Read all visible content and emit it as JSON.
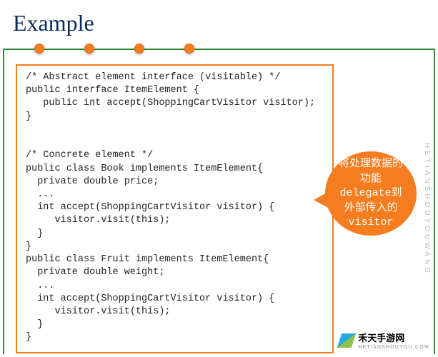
{
  "title": "Example",
  "code": "/* Abstract element interface (visitable) */\npublic interface ItemElement {\n   public int accept(ShoppingCartVisitor visitor);\n}\n\n\n/* Concrete element */\npublic class Book implements ItemElement{\n  private double price;\n  ...\n  int accept(ShoppingCartVisitor visitor) {\n     visitor.visit(this);\n  }\n}\npublic class Fruit implements ItemElement{\n  private double weight;\n  ...\n  int accept(ShoppingCartVisitor visitor) {\n     visitor.visit(this);\n  }\n}",
  "bubble": {
    "line1": "将处理数据的",
    "line2": "功能",
    "line3_mono": "delegate",
    "line3_suffix": "到",
    "line4": "外部传入的",
    "line5_mono": "visitor"
  },
  "watermark": "HETIANSHOUYOUWANG",
  "brand": {
    "name": "禾天手游网",
    "sub": "HETIANSHOUYOU.COM"
  }
}
